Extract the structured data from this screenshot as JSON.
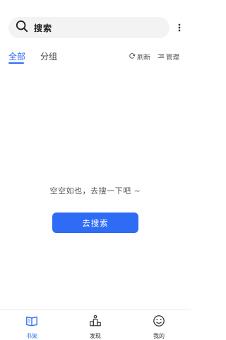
{
  "search": {
    "label": "搜索"
  },
  "tabs": [
    {
      "label": "全部"
    },
    {
      "label": "分组"
    }
  ],
  "actions": {
    "refresh": "刷新",
    "manage": "管理"
  },
  "empty_state": {
    "message": "空空如也，去搜一下吧 ~",
    "button": "去搜索"
  },
  "bottom_nav": [
    {
      "label": "书架"
    },
    {
      "label": "发现"
    },
    {
      "label": "我的"
    }
  ],
  "colors": {
    "accent": "#2f6cf6",
    "search_bg": "#f3f3f4",
    "text": "#222222"
  }
}
